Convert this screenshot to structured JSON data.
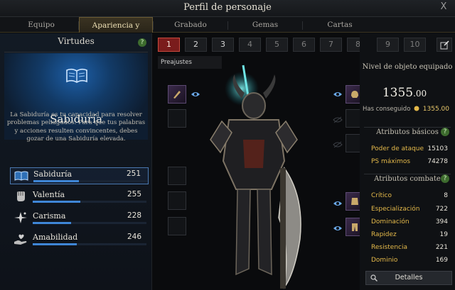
{
  "window": {
    "title": "Perfil de personaje",
    "close_label": "X"
  },
  "tabs": [
    {
      "label": "Equipo"
    },
    {
      "label": "Apariencia y virtudes",
      "active": true
    },
    {
      "label": "Grabado"
    },
    {
      "label": "Gemas"
    },
    {
      "label": "Cartas"
    }
  ],
  "virtues": {
    "header": "Virtudes",
    "help_label": "?",
    "selected": {
      "name": "Sabiduría",
      "icon": "open-book-icon",
      "description": "La Sabiduría es tu capacidad para resolver problemas peliagudos. Para que tus palabras y acciones resulten convincentes, debes gozar de una Sabiduría elevada."
    },
    "stats": [
      {
        "label": "Sabiduría",
        "value": "251",
        "icon": "book-icon",
        "fill": 0.4
      },
      {
        "label": "Valentía",
        "value": "255",
        "icon": "fist-icon",
        "fill": 0.42
      },
      {
        "label": "Carisma",
        "value": "228",
        "icon": "sparkle-icon",
        "fill": 0.34
      },
      {
        "label": "Amabilidad",
        "value": "246",
        "icon": "heart-hand-icon",
        "fill": 0.39
      }
    ]
  },
  "presets": {
    "buttons": [
      "1",
      "2",
      "3",
      "4",
      "5",
      "6",
      "7",
      "8",
      "9",
      "10"
    ],
    "active": "1",
    "lit": [
      "2",
      "3"
    ],
    "label": "Preajustes",
    "edit_icon": "edit-icon"
  },
  "item_level": {
    "title": "Nivel de objeto equipado",
    "value_int": "1355",
    "value_dec": ".00",
    "achieved_label": "Has conseguido",
    "achieved_value": "1355.00"
  },
  "basic": {
    "title": "Atributos básicos",
    "help_label": "?",
    "rows": [
      {
        "k": "Poder de ataque",
        "v": "15103"
      },
      {
        "k": "PS máximos",
        "v": "74278"
      }
    ]
  },
  "combat": {
    "title": "Atributos combate",
    "help_label": "?",
    "rows": [
      {
        "k": "Crítico",
        "v": "8"
      },
      {
        "k": "Especialización",
        "v": "722"
      },
      {
        "k": "Dominación",
        "v": "394"
      },
      {
        "k": "Rapidez",
        "v": "19"
      },
      {
        "k": "Resistencia",
        "v": "221"
      },
      {
        "k": "Dominio",
        "v": "169"
      }
    ]
  },
  "details_label": "Detalles",
  "colors": {
    "accent": "#3f86d6",
    "gold": "#e4b94a",
    "active_preset": "#7a1c1c"
  }
}
